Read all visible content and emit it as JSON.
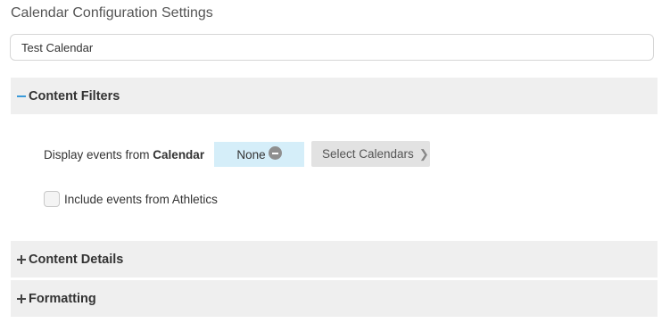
{
  "page": {
    "title": "Calendar Configuration Settings"
  },
  "calendar_name": {
    "value": "Test Calendar"
  },
  "sections": {
    "content_filters": {
      "label": "Content Filters",
      "expanded": true
    },
    "content_details": {
      "label": "Content Details",
      "expanded": false
    },
    "formatting": {
      "label": "Formatting",
      "expanded": false
    }
  },
  "filters": {
    "display_prefix": "Display events from ",
    "display_source": "Calendar",
    "selected_value": "None",
    "select_button": "Select Calendars",
    "include_label": "Include events from Athletics",
    "include_checked": false
  },
  "colors": {
    "accent": "#3a9ad9",
    "chip_bg": "#d5eef9",
    "header_bg": "#efefef"
  }
}
